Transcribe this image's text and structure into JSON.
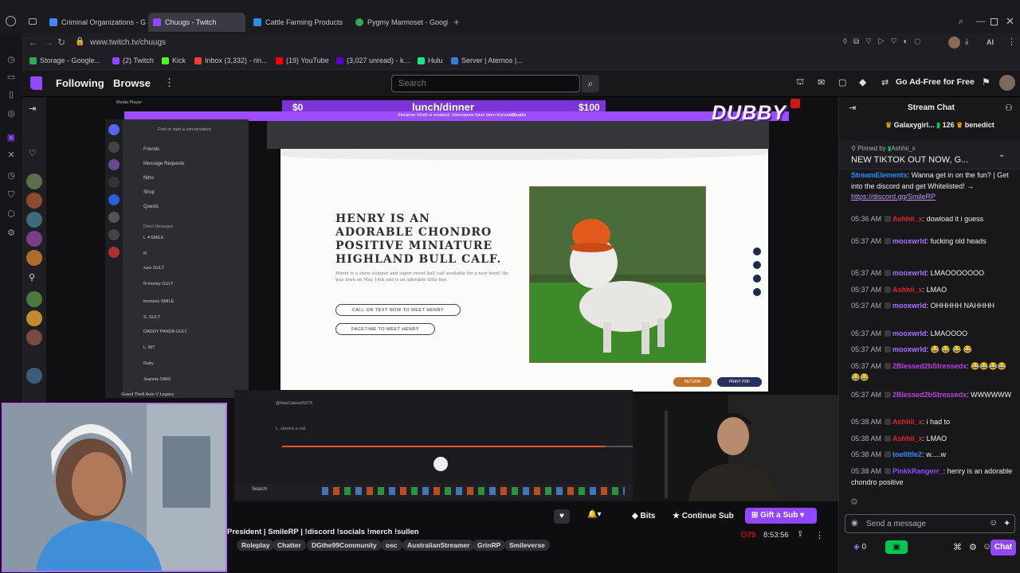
{
  "browser": {
    "tabs": [
      {
        "title": "Criminal Organizations - G",
        "color": "#4285f4"
      },
      {
        "title": "Chuugs - Twitch",
        "color": "#9146ff"
      },
      {
        "title": "Cattle Farming Products",
        "color": "#2f8de4"
      },
      {
        "title": "Pygmy Marmoset - Googl",
        "color": "#34a853"
      }
    ],
    "url": "www.twitch.tv/chuugs",
    "bookmarks": [
      {
        "label": "Storage - Google...",
        "color": "#34a853"
      },
      {
        "label": "(2) Twitch",
        "color": "#9146ff"
      },
      {
        "label": "Kick",
        "color": "#53fc18"
      },
      {
        "label": "Inbox (3,332) - rin...",
        "color": "#ea4335"
      },
      {
        "label": "(19) YouTube",
        "color": "#ff0000"
      },
      {
        "label": "(3,027 unread) - k...",
        "color": "#6001d2"
      },
      {
        "label": "Hulu",
        "color": "#1ce783"
      },
      {
        "label": "Server | Aternos |...",
        "color": "#3a7bd5"
      }
    ]
  },
  "twitch": {
    "nav": {
      "following": "Following",
      "browse": "Browse",
      "search_placeholder": "Search",
      "ad_free": "Go Ad-Free for Free"
    },
    "video": {
      "media_player": "Media Player",
      "goal_left": "$0",
      "goal_title": "lunch/dinner",
      "goal_right": "$100",
      "streamer_mode": "Streamer Mode is enabled. Usernames have been truncated.",
      "disable": "Disable",
      "dubby": "DUBBY",
      "discord": {
        "find_convo": "Find or start a conversation",
        "friends": "Friends",
        "message_requests": "Message Requests",
        "nitro": "Nitro",
        "shop": "Shop",
        "quests": "Quests",
        "direct_messages": "Direct Messages",
        "gta": "Grand Theft Auto V Legacy",
        "dm_names": [
          "L ✦SMILE",
          "R.",
          "ᴀʟᴇx GULT",
          "R-Honey GULT",
          "bossess SMILE",
          "S. GULT",
          "DADDY PANDA GULT",
          "L. BIT",
          "Ruby",
          "Jeannie SIMS"
        ],
        "hascakes": "@HasCakes#1675",
        "started_call": "L. started a call."
      },
      "page": {
        "title": "Henry is an adorable chondro positive miniature highland bull calf.",
        "desc": "Henry is a show stopper and super sweet bull calf available for a new herd! He was born on May 14th and is an adorable little boy.",
        "btn_call": "CALL OR TEXT NOW TO MEET HENRY",
        "btn_facetime": "FACETIME TO MEET HENRY",
        "btn_return": "RETURN",
        "btn_print": "PRINT PDF"
      },
      "taskbar_search": "Search"
    },
    "stream": {
      "title": "President | SmileRP | !discord !socials !merch !sullen",
      "tags": [
        "Roleplay",
        "Chatter",
        "DGthe99Community",
        "osc",
        "AustralianStreamer",
        "GrinRP",
        "Smileverse"
      ],
      "viewers": "79",
      "uptime": "8:53:56",
      "bits": "Bits",
      "continue_sub": "Continue Sub",
      "gift_sub": "Gift a Sub"
    },
    "chat": {
      "header": "Stream Chat",
      "gift_user": "Galaxygirl...",
      "gift_count": "126",
      "gift_user2": "benedict",
      "pinned_by": "Pinned by",
      "pinned_user": "Ashhii_x",
      "pinned_text": "NEW TIKTOK OUT NOW, G...",
      "messages": [
        {
          "time": "",
          "user": "StreamElements",
          "cls": "u-blue",
          "text": "Wanna get in on the fun? | Get into the discord and get Whitelisted! →",
          "link": "https://discord.gg/SmileRP"
        },
        {
          "time": "05:36 AM",
          "user": "Ashhii_x",
          "cls": "u-red",
          "text": "dowload it i guess"
        },
        {
          "time": "05:37 AM",
          "user": "mooxwrld",
          "cls": "u-purple",
          "text": "fucking old heads"
        },
        {
          "time": "05:37 AM",
          "user": "mooxwrld",
          "cls": "u-purple",
          "text": "LMAOOOOOOO"
        },
        {
          "time": "05:37 AM",
          "user": "Ashhii_x",
          "cls": "u-red",
          "text": "LMAO"
        },
        {
          "time": "05:37 AM",
          "user": "mooxwrld",
          "cls": "u-purple",
          "text": "OHHHHH NAHHHH"
        },
        {
          "time": "05:37 AM",
          "user": "mooxwrld",
          "cls": "u-purple",
          "text": "LMAOOOO"
        },
        {
          "time": "05:37 AM",
          "user": "mooxwrld",
          "cls": "u-purple",
          "text": "😂 😂 😂 😂"
        },
        {
          "time": "05:37 AM",
          "user": "2Blessed2bStressedx",
          "cls": "u-magenta",
          "text": "😂😂😂😂😂😂"
        },
        {
          "time": "05:37 AM",
          "user": "2Blessed2bStressedx",
          "cls": "u-magenta",
          "text": "WWWWWW"
        },
        {
          "time": "05:38 AM",
          "user": "Ashhii_x",
          "cls": "u-red",
          "text": "i had to"
        },
        {
          "time": "05:38 AM",
          "user": "Ashhii_x",
          "cls": "u-red",
          "text": "LMAO"
        },
        {
          "time": "05:38 AM",
          "user": "toelittle2",
          "cls": "u-blue",
          "text": "w.....w"
        },
        {
          "time": "05:38 AM",
          "user": "PinkkRangerr_",
          "cls": "u-violet",
          "text": "henry is an adorable chondro positive"
        }
      ],
      "send_placeholder": "Send a message",
      "points": "0",
      "chat_btn": "Chat"
    }
  },
  "colors": {
    "twitch_purple": "#9147ff",
    "goal_bar": "#7b34d6"
  }
}
